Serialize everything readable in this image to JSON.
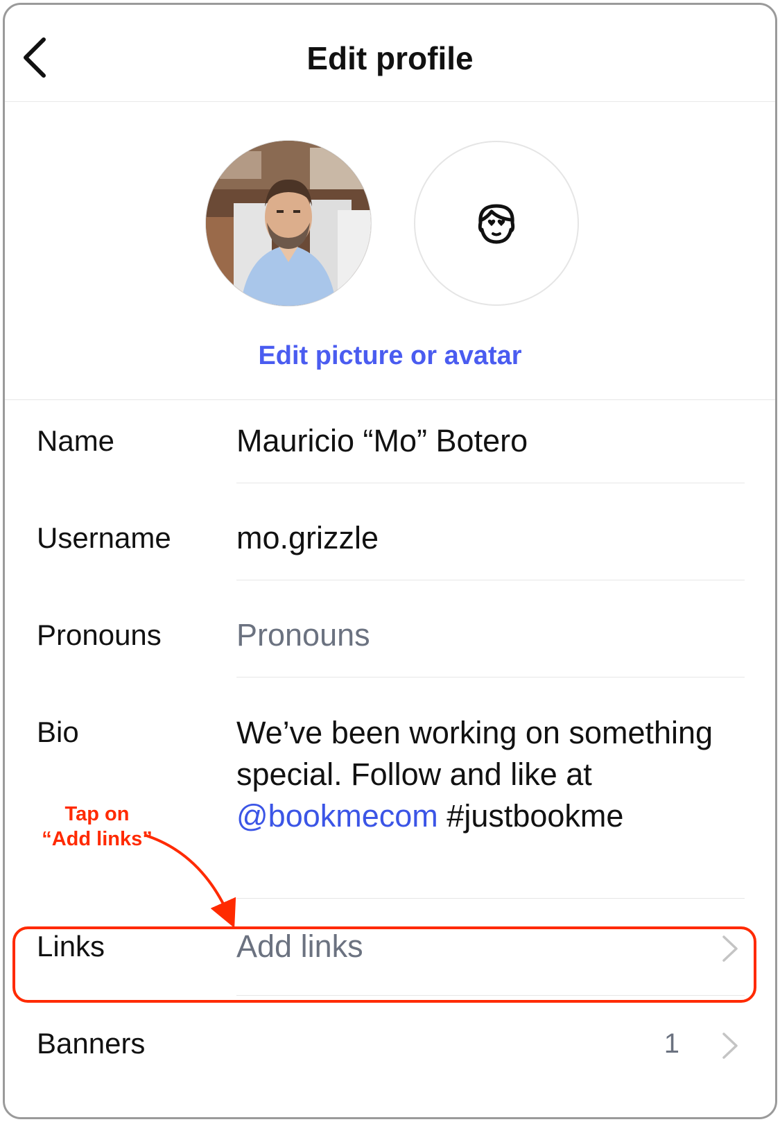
{
  "header": {
    "title": "Edit profile",
    "back_icon": "chevron-left-icon"
  },
  "avatars": {
    "edit_label": "Edit picture or avatar",
    "avatar_icon": "avatar-face-icon"
  },
  "fields": {
    "name": {
      "label": "Name",
      "value": "Mauricio “Mo” Botero"
    },
    "username": {
      "label": "Username",
      "value": "mo.grizzle"
    },
    "pronouns": {
      "label": "Pronouns",
      "placeholder": "Pronouns"
    },
    "bio": {
      "label": "Bio",
      "text_before": "We’ve been working on something special. Follow and like at ",
      "mention": "@bookmecom",
      "text_after": " #justbookme"
    },
    "links": {
      "label": "Links",
      "placeholder": "Add links"
    },
    "banners": {
      "label": "Banners",
      "count": "1"
    }
  },
  "annotation": {
    "line1": "Tap on",
    "line2": "“Add links”",
    "color": "#ff2a00"
  },
  "colors": {
    "accent": "#4a5cf0",
    "placeholder": "#6b7280"
  }
}
